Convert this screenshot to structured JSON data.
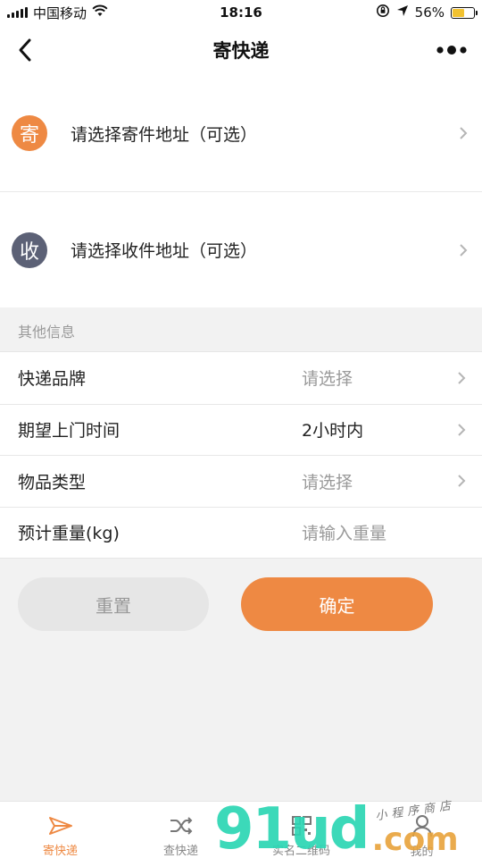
{
  "status_bar": {
    "carrier": "中国移动",
    "time": "18:16",
    "battery": "56%",
    "battery_level": 0.56
  },
  "nav": {
    "title": "寄快递"
  },
  "address": {
    "sender": {
      "badge": "寄",
      "text": "请选择寄件地址（可选）",
      "color": "#ee8943"
    },
    "receiver": {
      "badge": "收",
      "text": "请选择收件地址（可选）",
      "color": "#5c6176"
    }
  },
  "other_info": {
    "header": "其他信息",
    "rows": [
      {
        "label": "快递品牌",
        "value": "请选择"
      },
      {
        "label": "期望上门时间",
        "value": "2小时内"
      },
      {
        "label": "物品类型",
        "value": "请选择"
      },
      {
        "label": "预计重量(kg)",
        "placeholder": "请输入重量"
      }
    ]
  },
  "buttons": {
    "reset": "重置",
    "confirm": "确定"
  },
  "tab_bar": {
    "items": [
      {
        "label": "寄快递",
        "icon": "paper-plane-icon"
      },
      {
        "label": "查快递",
        "icon": "shuffle-icon"
      },
      {
        "label": "实名二维码",
        "icon": "qr-code-icon"
      },
      {
        "label": "我的",
        "icon": "user-icon"
      }
    ],
    "active_color": "#ee8943"
  },
  "watermark": {
    "main": "91ud",
    "suffix": ".com",
    "sub": "小程序商店"
  }
}
